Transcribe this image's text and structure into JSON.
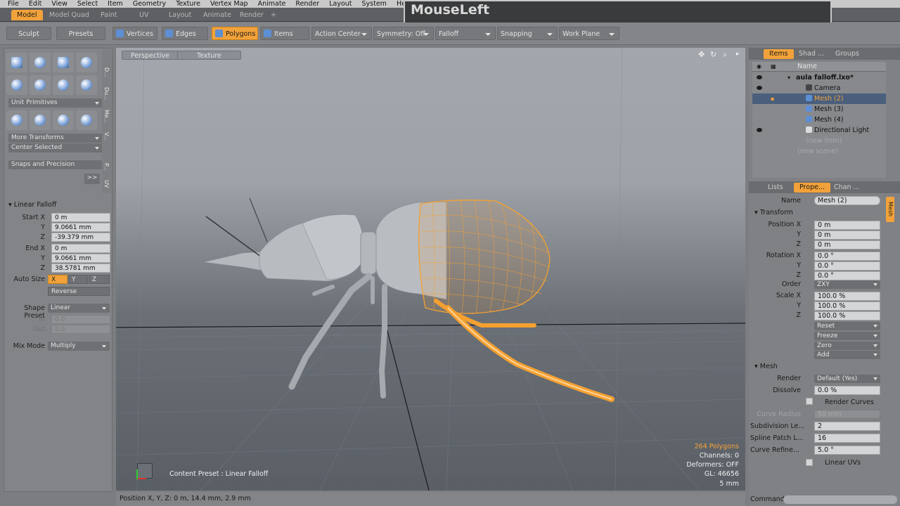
{
  "menu": [
    "File",
    "Edit",
    "View",
    "Select",
    "Item",
    "Geometry",
    "Texture",
    "Vertex Map",
    "Animate",
    "Render",
    "Layout",
    "System",
    "Help"
  ],
  "layout_tabs": [
    "Model",
    "Model Quad",
    "Paint",
    "UV",
    "Layout",
    "Animate",
    "Render",
    "+"
  ],
  "banner_text": "MouseLeft",
  "toolbar": {
    "sculpt": "Sculpt",
    "presets": "Presets",
    "vertices": "Vertices",
    "edges": "Edges",
    "polygons": "Polygons",
    "items": "Items",
    "action_center": "Action Center",
    "symmetry": "Symmetry: Off",
    "falloff": "Falloff",
    "snapping": "Snapping",
    "work_plane": "Work Plane"
  },
  "left_panel": {
    "vtabs": [
      "D...",
      "Du...",
      "Me...",
      "V...",
      "P...",
      "UV"
    ],
    "unit_primitives": "Unit Primitives",
    "more_transforms": "More Transforms",
    "center_selected": "Center Selected",
    "snaps": "Snaps and Precision",
    "expand": ">>",
    "falloff_title": "Linear Falloff",
    "start_x_label": "Start X",
    "y_label": "Y",
    "z_label": "Z",
    "end_x_label": "End X",
    "start_x": "0 m",
    "start_y": "9.0661 mm",
    "start_z": "-39.379 mm",
    "end_x": "0 m",
    "end_y": "9.0661 mm",
    "end_z": "38.5781 mm",
    "auto_size_label": "Auto Size",
    "axis_x": "X",
    "axis_y": "Y",
    "axis_z": "Z",
    "reverse": "Reverse",
    "shape_preset_label": "Shape Preset",
    "shape_preset": "Linear",
    "in_label": "In",
    "out_label": "Out",
    "in_value": "0.0",
    "out_value": "0.0",
    "mix_mode_label": "Mix Mode",
    "mix_mode": "Multiply"
  },
  "viewport": {
    "perspective": "Perspective",
    "texture": "Texture",
    "content_preset": "Content Preset : Linear Falloff",
    "polygons": "264 Polygons",
    "channels": "Channels: 0",
    "deformers": "Deformers: OFF",
    "gl": "GL: 46656",
    "scale": "5 mm"
  },
  "status_bar": "Position X, Y, Z:  0 m, 14.4 mm, 2.9 mm",
  "right_panel": {
    "tabs_top": [
      "Items",
      "Shad ...",
      "Groups"
    ],
    "column_name": "Name",
    "scene": "aula falloff.lxo*",
    "items": [
      "Camera",
      "Mesh (2)",
      "Mesh (3)",
      "Mesh (4)",
      "Directional Light"
    ],
    "new_item": "(new item)",
    "new_scene": "(new scene)",
    "tabs_bottom": [
      "Lists",
      "Prope...",
      "Chan ..."
    ],
    "name_label": "Name",
    "name_value": "Mesh (2)",
    "side_tab": "Mesh",
    "transform": "Transform",
    "position_x_label": "Position X",
    "y_label": "Y",
    "z_label": "Z",
    "position": [
      "0 m",
      "0 m",
      "0 m"
    ],
    "rotation_x_label": "Rotation X",
    "rotation": [
      "0.0 °",
      "0.0 °",
      "0.0 °"
    ],
    "order_label": "Order",
    "order": "ZXY",
    "scale_x_label": "Scale X",
    "scale": [
      "100.0 %",
      "100.0 %",
      "100.0 %"
    ],
    "reset": "Reset",
    "freeze": "Freeze",
    "zero": "Zero",
    "add": "Add",
    "mesh_section": "Mesh",
    "render_label": "Render",
    "render": "Default (Yes)",
    "dissolve_label": "Dissolve",
    "dissolve": "0.0 %",
    "render_curves": "Render Curves",
    "curve_radius_label": "Curve Radius",
    "curve_radius": "50 mm",
    "subdivision_label": "Subdivision Le...",
    "subdivision": "2",
    "spline_label": "Spline Patch L...",
    "spline": "16",
    "curve_refine_label": "Curve Refine...",
    "curve_refine": "5.0 °",
    "linear_uvs": "Linear UVs",
    "command_label": "Command"
  },
  "colors": {
    "accent": "#f2a23a",
    "wireframe": "#f5a030",
    "selection": "#4a5f7c"
  }
}
